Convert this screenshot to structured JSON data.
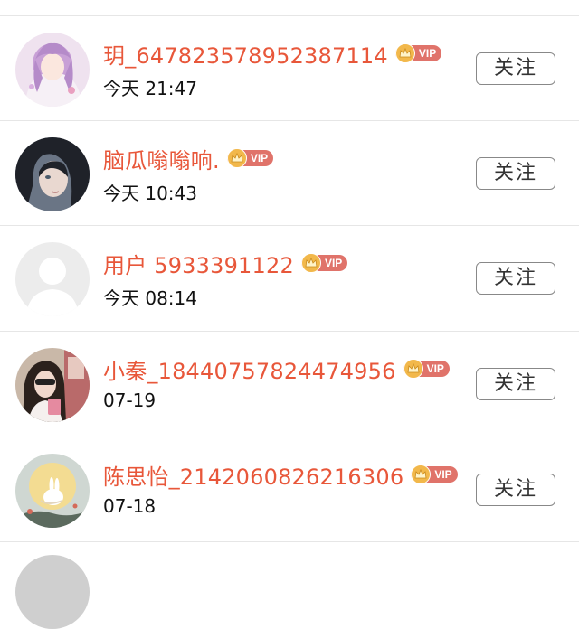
{
  "follow_label": "关注",
  "vip_label": "VIP",
  "users": [
    {
      "name": "玥_647823578952387114",
      "time": "今天 21:47",
      "avatar": "anime-girl-lavender"
    },
    {
      "name": "脑瓜嗡嗡响.",
      "time": "今天 10:43",
      "avatar": "dark-hair-portrait"
    },
    {
      "name": "用户 5933391122",
      "time": "今天 08:14",
      "avatar": "default-silhouette"
    },
    {
      "name": "小秦_18440757824474956",
      "time": "07-19",
      "avatar": "selfie-photo"
    },
    {
      "name": "陈思怡_2142060826216306",
      "time": "07-18",
      "avatar": "moon-rabbit"
    }
  ],
  "colors": {
    "name": "#e8573a",
    "vip_pill": "#e0736a",
    "crown": "#f2b84b",
    "divider": "#e6e6e6"
  }
}
